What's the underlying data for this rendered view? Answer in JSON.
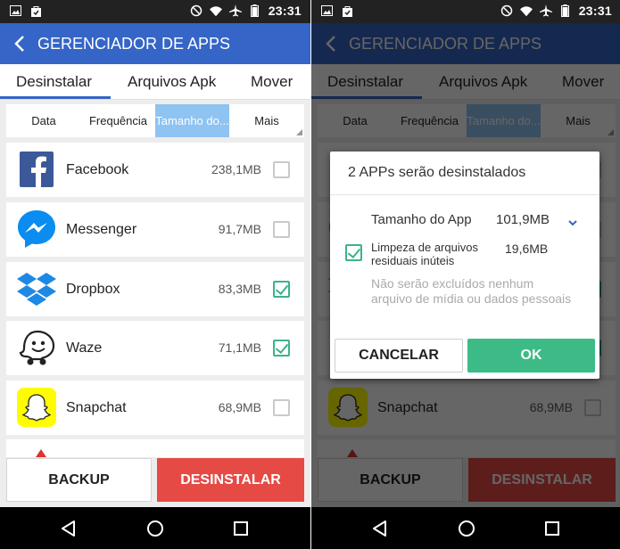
{
  "status_bar": {
    "time": "23:31"
  },
  "app_bar": {
    "title": "GERENCIADOR DE APPS"
  },
  "tabs": [
    {
      "label": "Desinstalar"
    },
    {
      "label": "Arquivos Apk"
    },
    {
      "label": "Mover"
    }
  ],
  "sort": [
    {
      "label": "Data"
    },
    {
      "label": "Frequência"
    },
    {
      "label": "Tamanho do..."
    },
    {
      "label": "Mais"
    }
  ],
  "apps": [
    {
      "name": "Facebook",
      "size": "238,1MB",
      "checked": false,
      "icon": "facebook-icon"
    },
    {
      "name": "Messenger",
      "size": "91,7MB",
      "checked": false,
      "icon": "messenger-icon"
    },
    {
      "name": "Dropbox",
      "size": "83,3MB",
      "checked": true,
      "icon": "dropbox-icon"
    },
    {
      "name": "Waze",
      "size": "71,1MB",
      "checked": true,
      "icon": "waze-icon"
    },
    {
      "name": "Snapchat",
      "size": "68,9MB",
      "checked": false,
      "icon": "snapchat-icon"
    }
  ],
  "buttons": {
    "backup": "BACKUP",
    "uninstall": "DESINSTALAR"
  },
  "dialog": {
    "title": "2 APPs serão desinstalados",
    "app_size_label": "Tamanho do App",
    "app_size_value": "101,9MB",
    "junk_label": "Limpeza de arquivos residuais inúteis",
    "junk_value": "19,6MB",
    "junk_checked": true,
    "note": "Não serão excluídos nenhum arquivo de mídia ou dados pessoais",
    "cancel": "CANCELAR",
    "ok": "OK"
  },
  "colors": {
    "primary": "#3565c6",
    "accent_green": "#3dbb86",
    "danger": "#e64a45",
    "selected_sort": "#8ec3f2"
  }
}
